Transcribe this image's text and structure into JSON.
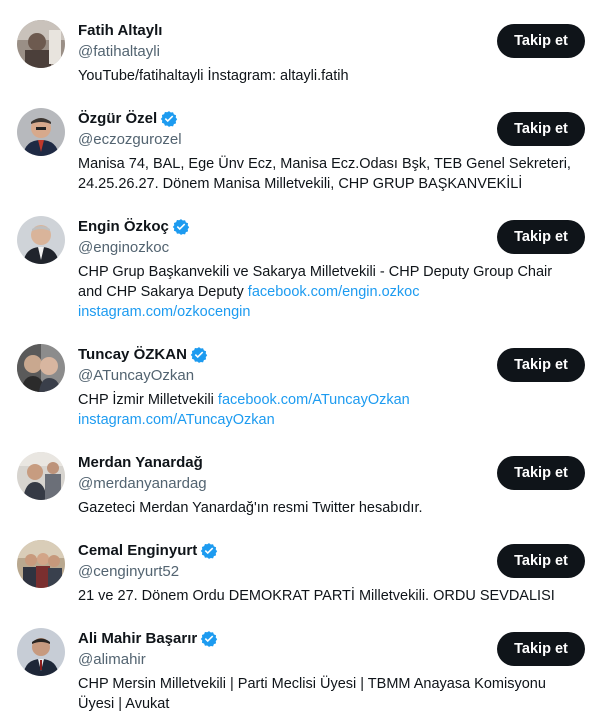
{
  "follow_label": "Takip et",
  "accounts": [
    {
      "name": "Fatih Altaylı",
      "handle": "@fatihaltayli",
      "verified": false,
      "bio": [
        {
          "t": "YouTube/fatihaltayli İnstagram: altayli.fatih"
        }
      ]
    },
    {
      "name": "Özgür Özel",
      "handle": "@eczozgurozel",
      "verified": true,
      "bio": [
        {
          "t": "Manisa 74, BAL, Ege Ünv Ecz, Manisa Ecz.Odası Bşk, TEB Genel Sekreteri, 24.25.26.27. Dönem Manisa Milletvekili, CHP GRUP BAŞKANVEKİLİ"
        }
      ]
    },
    {
      "name": "Engin Özkoç",
      "handle": "@enginozkoc",
      "verified": true,
      "bio": [
        {
          "t": "CHP Grup Başkanvekili ve Sakarya Milletvekili - CHP Deputy Group Chair and CHP Sakarya Deputy "
        },
        {
          "t": "facebook.com/engin.ozkoc",
          "link": true
        },
        {
          "t": " "
        },
        {
          "t": "instagram.com/ozkocengin",
          "link": true
        }
      ]
    },
    {
      "name": "Tuncay ÖZKAN",
      "handle": "@ATuncayOzkan",
      "verified": true,
      "bio": [
        {
          "t": "CHP İzmir Milletvekili "
        },
        {
          "t": "facebook.com/ATuncayOzkan",
          "link": true
        },
        {
          "t": " "
        },
        {
          "t": "instagram.com/ATuncayOzkan",
          "link": true
        }
      ]
    },
    {
      "name": "Merdan Yanardağ",
      "handle": "@merdanyanardag",
      "verified": false,
      "bio": [
        {
          "t": "Gazeteci Merdan Yanardağ'ın resmi Twitter hesabıdır."
        }
      ]
    },
    {
      "name": "Cemal Enginyurt",
      "handle": "@cenginyurt52",
      "verified": true,
      "bio": [
        {
          "t": "21 ve 27. Dönem Ordu DEMOKRAT PARTİ Milletvekili. ORDU SEVDALISI"
        }
      ]
    },
    {
      "name": "Ali Mahir Başarır",
      "handle": "@alimahir",
      "verified": true,
      "bio": [
        {
          "t": "CHP Mersin Milletvekili | Parti Meclisi Üyesi | TBMM Anayasa Komisyonu Üyesi | Avukat"
        }
      ]
    }
  ],
  "colors": {
    "button": "#0f1419",
    "link": "#1d9bf0",
    "verified": "#1d9bf0",
    "handle": "#536471"
  }
}
